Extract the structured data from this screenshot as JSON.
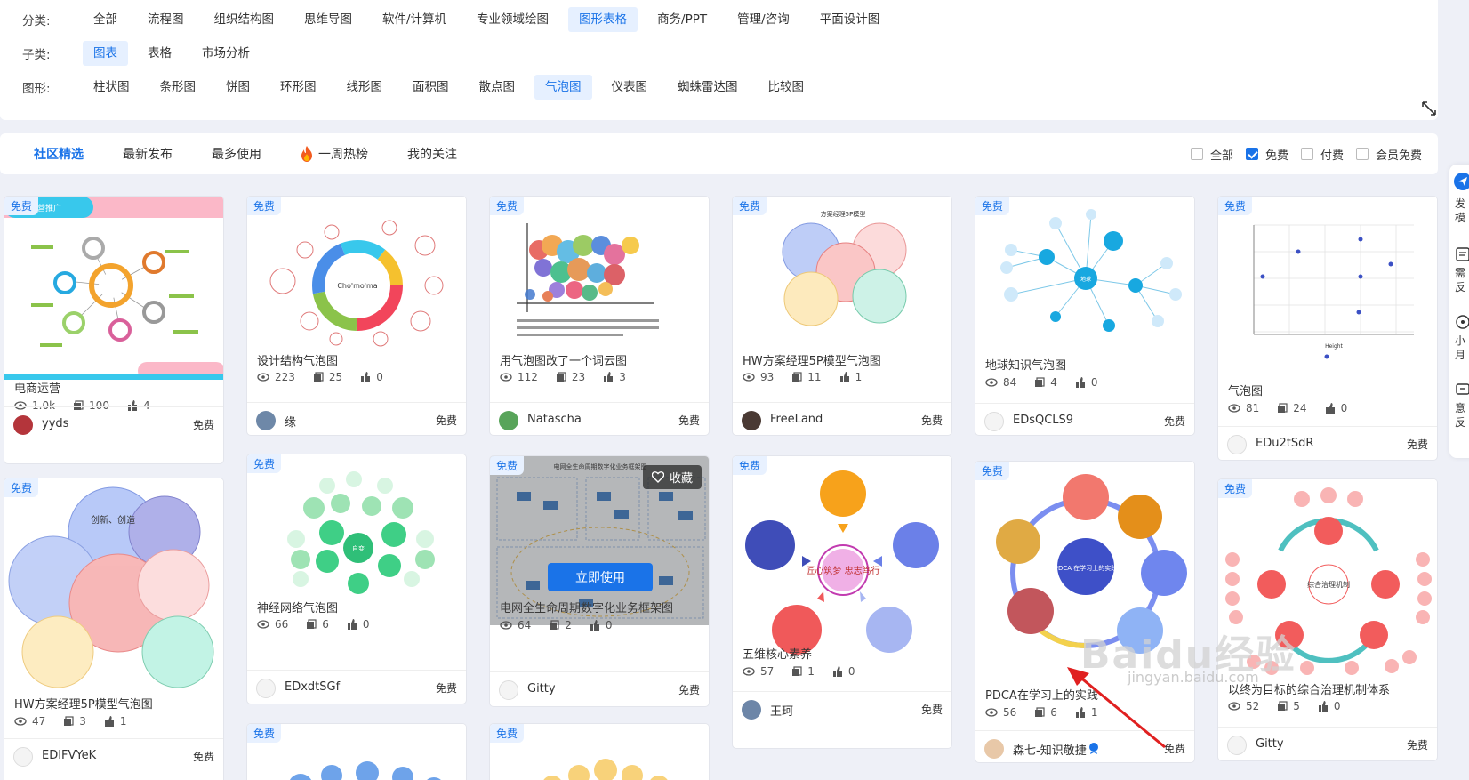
{
  "filters": {
    "category": {
      "label": "分类:",
      "items": [
        "全部",
        "流程图",
        "组织结构图",
        "思维导图",
        "软件/计算机",
        "专业领域绘图",
        "图形表格",
        "商务/PPT",
        "管理/咨询",
        "平面设计图"
      ],
      "active": 6
    },
    "subcategory": {
      "label": "子类:",
      "items": [
        "图表",
        "表格",
        "市场分析"
      ],
      "active": 0
    },
    "shape": {
      "label": "图形:",
      "items": [
        "柱状图",
        "条形图",
        "饼图",
        "环形图",
        "线形图",
        "面积图",
        "散点图",
        "气泡图",
        "仪表图",
        "蜘蛛雷达图",
        "比较图"
      ],
      "active": 7
    }
  },
  "tabs": {
    "items": [
      "社区精选",
      "最新发布",
      "最多使用",
      "一周热榜",
      "我的关注"
    ],
    "active": 0
  },
  "checkboxes": [
    {
      "label": "全部",
      "checked": false
    },
    {
      "label": "免费",
      "checked": true
    },
    {
      "label": "付费",
      "checked": false
    },
    {
      "label": "会员免费",
      "checked": false
    }
  ],
  "side_panel": [
    "发 模",
    "需 反",
    "小 月",
    "意 反"
  ],
  "badge_free": "免费",
  "hover": {
    "favorite": "收藏",
    "use": "立即使用"
  },
  "cards": [
    {
      "title": "电商运营",
      "views": "1.0k",
      "copies": "100",
      "likes": "4",
      "user": "yyds",
      "price": "免费",
      "thumb_text": "运营推广"
    },
    {
      "title": "设计结构气泡图",
      "views": "223",
      "copies": "25",
      "likes": "0",
      "user": "缘",
      "price": "免费",
      "thumb_text": "Cho'mo'ma"
    },
    {
      "title": "用气泡图改了一个词云图",
      "views": "112",
      "copies": "23",
      "likes": "3",
      "user": "Natascha",
      "price": "免费",
      "thumb_text": ""
    },
    {
      "title": "HW方案经理5P模型气泡图",
      "views": "93",
      "copies": "11",
      "likes": "1",
      "user": "FreeLand",
      "price": "免费",
      "thumb_text": "方案经理5P模型"
    },
    {
      "title": "地球知识气泡图",
      "views": "84",
      "copies": "4",
      "likes": "0",
      "user": "EDsQCLS9",
      "price": "免费",
      "thumb_text": "地球"
    },
    {
      "title": "气泡图",
      "views": "81",
      "copies": "24",
      "likes": "0",
      "user": "EDu2tSdR",
      "price": "免费",
      "thumb_text": "Height"
    },
    {
      "title": "HW方案经理5P模型气泡图",
      "views": "47",
      "copies": "3",
      "likes": "1",
      "user": "EDIFVYeK",
      "price": "免费",
      "thumb_text": "创新、创造"
    },
    {
      "title": "神经网络气泡图",
      "views": "66",
      "copies": "6",
      "likes": "0",
      "user": "EDxdtSGf",
      "price": "免费",
      "thumb_text": "自变"
    },
    {
      "title": "电网全生命周期数字化业务框架图",
      "views": "64",
      "copies": "2",
      "likes": "0",
      "user": "Gitty",
      "price": "免费",
      "thumb_text": "电网全生命周期数字化业务框架图"
    },
    {
      "title": "五维核心素养",
      "views": "57",
      "copies": "1",
      "likes": "0",
      "user": "王珂",
      "price": "免费",
      "thumb_text": "匠心筑梦 忠志笃行"
    },
    {
      "title": "PDCA在学习上的实践",
      "views": "56",
      "copies": "6",
      "likes": "1",
      "user": "森七-知识敬捷",
      "price": "免费",
      "thumb_text": "PDCA 在学习上的实践"
    },
    {
      "title": "以终为目标的综合治理机制体系",
      "views": "52",
      "copies": "5",
      "likes": "0",
      "user": "Gitty",
      "price": "免费",
      "thumb_text": "综合治理机制"
    }
  ],
  "watermark": {
    "brand": "Baidu经验",
    "url": "jingyan.baidu.com"
  }
}
